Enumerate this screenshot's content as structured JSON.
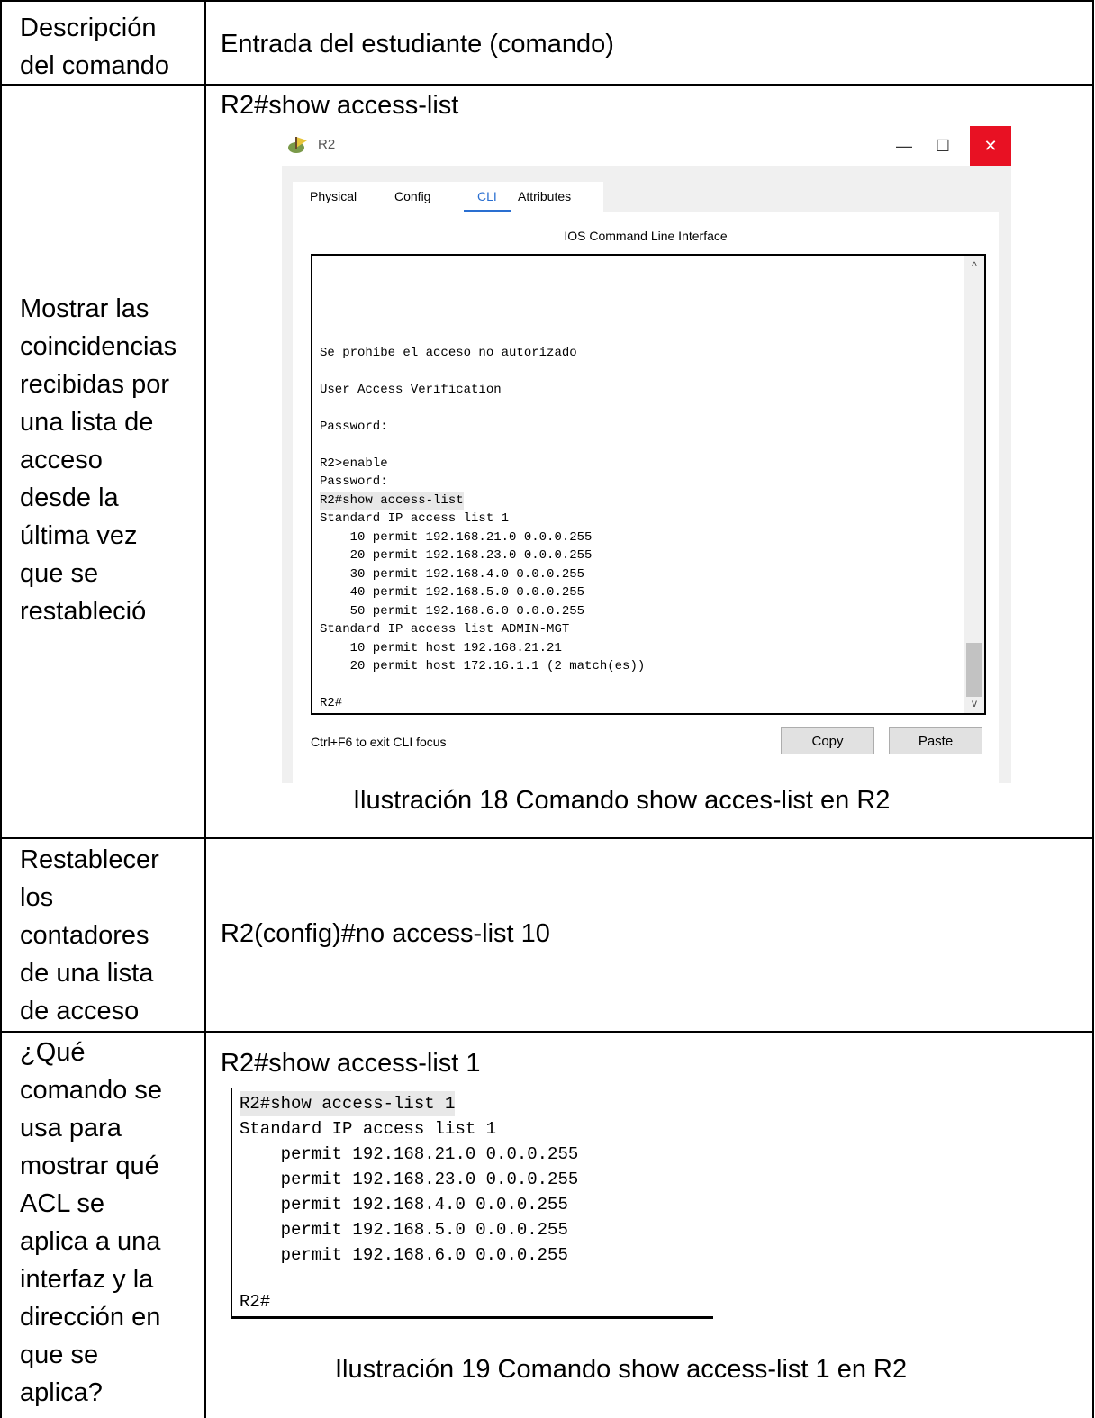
{
  "table": {
    "header": {
      "col1": [
        "Descripción",
        "del comando"
      ],
      "col2": "Entrada del estudiante (comando)"
    },
    "rows": [
      {
        "description": [
          "Mostrar las",
          "coincidencias",
          "recibidas por",
          "una lista de",
          "acceso",
          "desde la",
          "última vez",
          "que se",
          "restableció"
        ],
        "command": "R2#show access-list",
        "caption": "Ilustración 18 Comando show acces-list en R2"
      },
      {
        "description": [
          "Restablecer",
          "los",
          "contadores",
          "de una lista",
          "de acceso"
        ],
        "command": "R2(config)#no access-list 10"
      },
      {
        "description": [
          "¿Qué",
          "comando se",
          "usa para",
          "mostrar qué",
          "ACL se",
          "aplica a una",
          "interfaz y la",
          "dirección en",
          "que se",
          "aplica?"
        ],
        "command": "R2#show access-list 1",
        "caption": "Ilustración 19 Comando show access-list 1 en R2"
      }
    ]
  },
  "window": {
    "title": "R2",
    "minimize_icon": "—",
    "maximize_icon": "☐",
    "close_icon": "✕",
    "tabs": [
      "Physical",
      "Config",
      "CLI",
      "Attributes"
    ],
    "active_tab": "CLI",
    "panel_title": "IOS Command Line Interface",
    "terminal_lines": [
      "Se prohibe el acceso no autorizado",
      "User Access Verification",
      "Password:",
      "R2>enable",
      "Password:",
      "R2#show access-list",
      "Standard IP access list 1",
      "    10 permit 192.168.21.0 0.0.0.255",
      "    20 permit 192.168.23.0 0.0.0.255",
      "    30 permit 192.168.4.0 0.0.0.255",
      "    40 permit 192.168.5.0 0.0.0.255",
      "    50 permit 192.168.6.0 0.0.0.255",
      "Standard IP access list ADMIN-MGT",
      "    10 permit host 192.168.21.21",
      "    20 permit host 172.16.1.1 (2 match(es))",
      "R2#"
    ],
    "hint": "Ctrl+F6 to exit CLI focus",
    "copy_label": "Copy",
    "paste_label": "Paste",
    "scroll_up_icon": "^",
    "scroll_down_icon": "v"
  },
  "snippet": {
    "lines": [
      "R2#show access-list 1",
      "Standard IP access list 1",
      "    permit 192.168.21.0 0.0.0.255",
      "    permit 192.168.23.0 0.0.0.255",
      "    permit 192.168.4.0 0.0.0.255",
      "    permit 192.168.5.0 0.0.0.255",
      "    permit 192.168.6.0 0.0.0.255",
      "",
      "R2#"
    ]
  },
  "colors": {
    "accent": "#2a6fd1",
    "close": "#e81123",
    "highlight": "#e8e8e8"
  }
}
